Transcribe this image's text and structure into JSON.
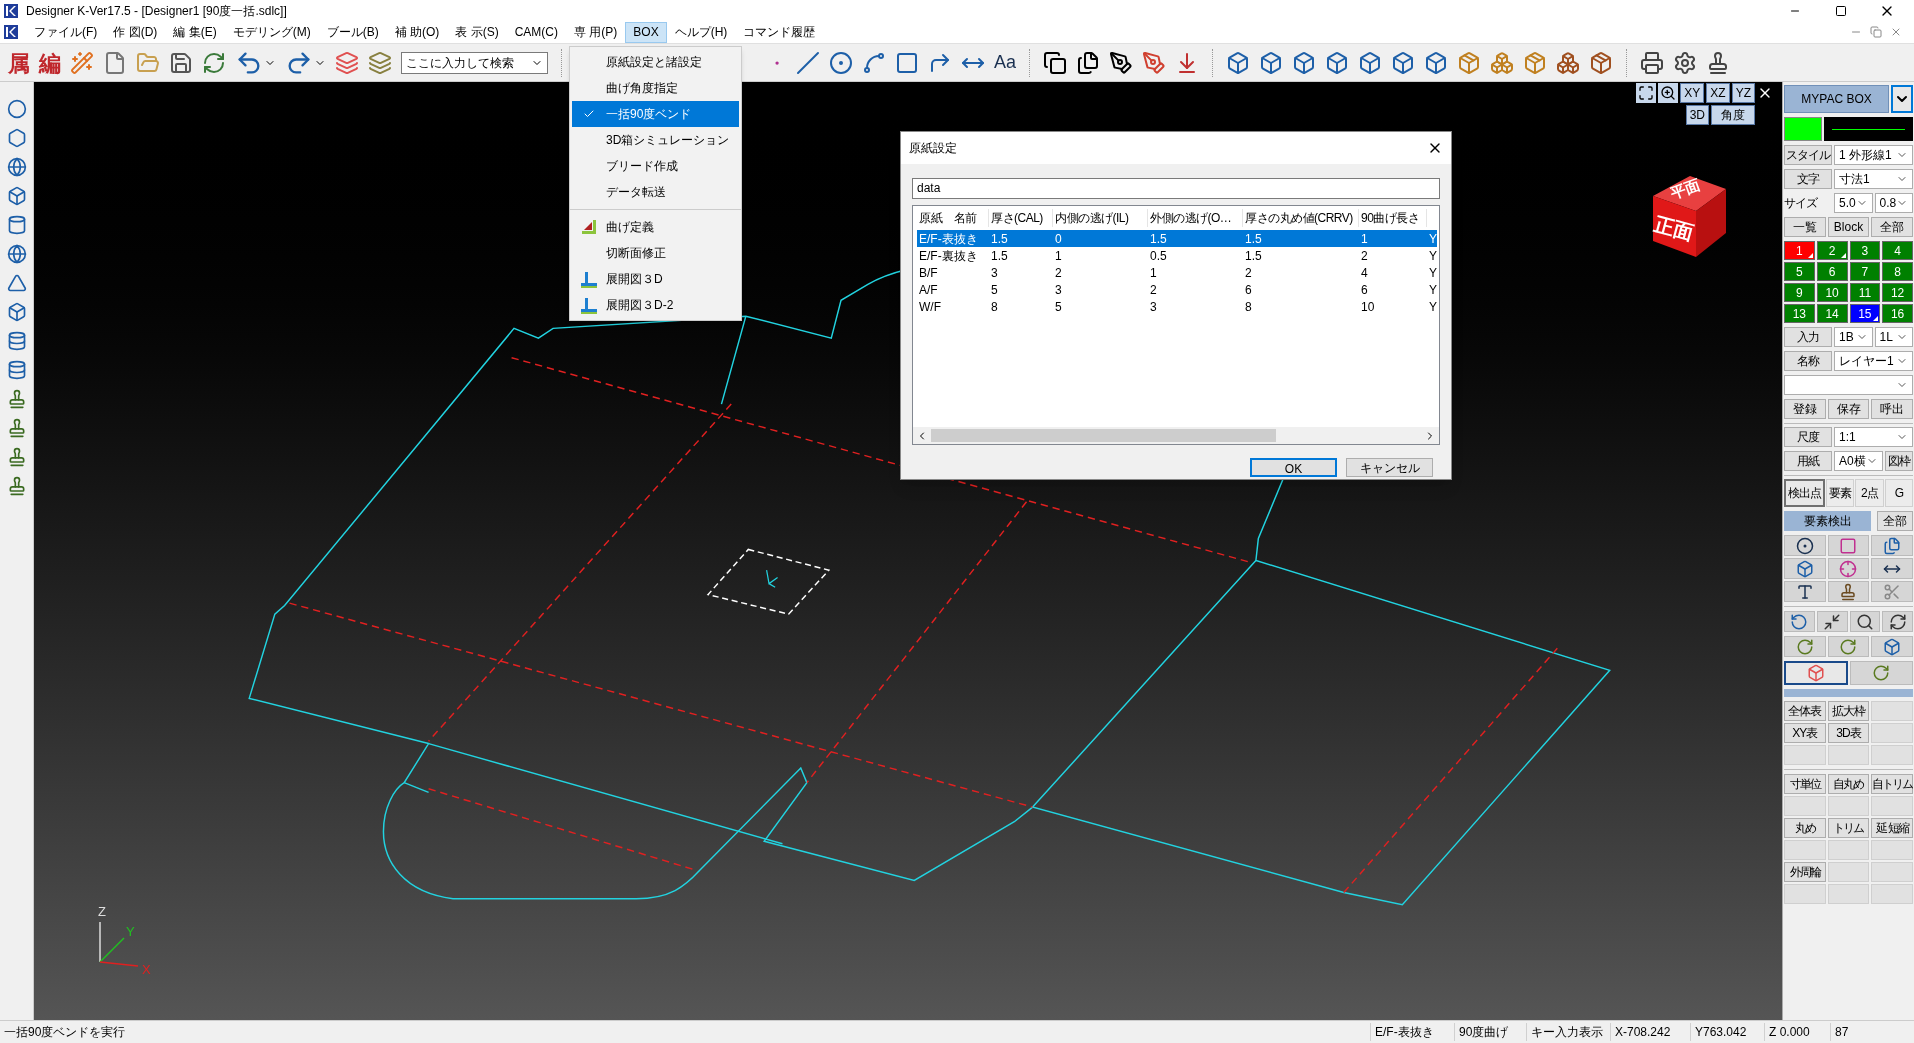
{
  "window": {
    "title": "Designer K-Ver17.5 - [Designer1 [90度一括.sdlc]]"
  },
  "menu_bar": [
    {
      "label": "ファイル(F)",
      "selected": false
    },
    {
      "label": "作 図(D)",
      "selected": false
    },
    {
      "label": "編 集(E)",
      "selected": false
    },
    {
      "label": "モデリング(M)",
      "selected": false
    },
    {
      "label": "ブール(B)",
      "selected": false
    },
    {
      "label": "補 助(O)",
      "selected": false
    },
    {
      "label": "表 示(S)",
      "selected": false
    },
    {
      "label": "CAM(C)",
      "selected": false
    },
    {
      "label": "専 用(P)",
      "selected": false
    },
    {
      "label": "BOX",
      "selected": true
    },
    {
      "label": "ヘルプ(H)",
      "selected": false
    },
    {
      "label": "コマンド履歴",
      "selected": false
    }
  ],
  "toolbar": {
    "glyphs": [
      "属",
      "編"
    ],
    "search": {
      "placeholder": "ここに入力して検索"
    },
    "text_tool": "Aa"
  },
  "box_menu": {
    "groups": [
      [
        {
          "label": "原紙設定と諸設定",
          "kind": "plain",
          "checked": false,
          "selected": false
        },
        {
          "label": "曲げ角度指定",
          "kind": "plain",
          "checked": false,
          "selected": false
        },
        {
          "label": "一括90度ベンド",
          "kind": "plain",
          "checked": true,
          "selected": true
        },
        {
          "label": "3D箱シミュレーション",
          "kind": "plain",
          "checked": false,
          "selected": false
        },
        {
          "label": "ブリード作成",
          "kind": "plain",
          "checked": false,
          "selected": false
        },
        {
          "label": "データ転送",
          "kind": "plain",
          "checked": false,
          "selected": false
        }
      ],
      [
        {
          "label": "曲げ定義",
          "kind": "bend",
          "checked": false,
          "selected": false
        },
        {
          "label": "切断面修正",
          "kind": "plain",
          "checked": false,
          "selected": false
        },
        {
          "label": "展開図３D",
          "kind": "unfold",
          "checked": false,
          "selected": false
        },
        {
          "label": "展開図３D-2",
          "kind": "unfold",
          "checked": false,
          "selected": false
        }
      ]
    ]
  },
  "view_controls": {
    "planes": [
      "XY",
      "XZ",
      "YZ"
    ],
    "mode": "3D",
    "angle": "角度"
  },
  "view_cube": {
    "top": "平面",
    "front": "正面"
  },
  "axes": {
    "z": "Z",
    "y": "Y",
    "x": "X"
  },
  "dialog": {
    "title": "原紙設定",
    "name_field": {
      "value": "data"
    },
    "columns": [
      "原紙　名前",
      "厚さ(CAL)",
      "内側の逃げ(IL)",
      "外側の逃げ(O…",
      "厚さの丸め値(CRRV)",
      "90曲げ長さ"
    ],
    "rows": [
      {
        "cells": [
          "E/F-表抜き",
          "1.5",
          "0",
          "1.5",
          "1.5",
          "1",
          "Y"
        ],
        "selected": true
      },
      {
        "cells": [
          "E/F-裏抜き",
          "1.5",
          "1",
          "0.5",
          "1.5",
          "2",
          "Y"
        ],
        "selected": false
      },
      {
        "cells": [
          "B/F",
          "3",
          "2",
          "1",
          "2",
          "4",
          "Y"
        ],
        "selected": false
      },
      {
        "cells": [
          "A/F",
          "5",
          "3",
          "2",
          "6",
          "6",
          "Y"
        ],
        "selected": false
      },
      {
        "cells": [
          "W/F",
          "8",
          "5",
          "3",
          "8",
          "10",
          "Y"
        ],
        "selected": false
      }
    ],
    "buttons": [
      {
        "label": "OK",
        "default": true
      },
      {
        "label": "キャンセル",
        "default": false
      }
    ]
  },
  "right_panel": {
    "title": "MYPAC BOX",
    "style": {
      "label": "スタイル",
      "value": "1 外形線1"
    },
    "text": {
      "label": "文字",
      "value": "寸法1"
    },
    "size": {
      "label": "サイズ",
      "values": [
        "5.0",
        "0.8"
      ]
    },
    "list_buttons": [
      "一覧",
      "Block",
      "全部"
    ],
    "layers": [
      {
        "label": "1",
        "color": "#ff0000",
        "marked": true
      },
      {
        "label": "2",
        "color": "#008000",
        "marked": true
      },
      {
        "label": "3",
        "color": "#008000",
        "marked": false
      },
      {
        "label": "4",
        "color": "#008000",
        "marked": false
      },
      {
        "label": "5",
        "color": "#008000",
        "marked": false
      },
      {
        "label": "6",
        "color": "#008000",
        "marked": false
      },
      {
        "label": "7",
        "color": "#008000",
        "marked": false
      },
      {
        "label": "8",
        "color": "#008000",
        "marked": false
      },
      {
        "label": "9",
        "color": "#008000",
        "marked": false
      },
      {
        "label": "10",
        "color": "#008000",
        "marked": false
      },
      {
        "label": "11",
        "color": "#008000",
        "marked": false
      },
      {
        "label": "12",
        "color": "#008000",
        "marked": false
      },
      {
        "label": "13",
        "color": "#008000",
        "marked": false
      },
      {
        "label": "14",
        "color": "#008000",
        "marked": false
      },
      {
        "label": "15",
        "color": "#0000ff",
        "marked": true
      },
      {
        "label": "16",
        "color": "#008000",
        "marked": false
      }
    ],
    "input": {
      "label": "入力",
      "values": [
        "1B",
        "1L"
      ]
    },
    "name": {
      "label": "名称",
      "value": "レイヤー1"
    },
    "memory_buttons": [
      "登録",
      "保存",
      "呼出"
    ],
    "scale": {
      "label": "尺度",
      "value": "1:1"
    },
    "paper": {
      "label": "用紙",
      "value": "A0横",
      "frame": "図枠"
    },
    "snap_buttons": [
      {
        "label": "検出点",
        "selected": true
      },
      {
        "label": "要素",
        "selected": false
      },
      {
        "label": "2点",
        "selected": false
      },
      {
        "label": "G",
        "selected": false
      }
    ],
    "detect": {
      "label": "要素検出",
      "all": "全部"
    },
    "view_mode_buttons": [
      {
        "selected": true
      },
      {
        "selected": false
      }
    ],
    "display_buttons": [
      [
        "全体表",
        "拡大枠"
      ],
      [
        "XY表",
        "3D表"
      ]
    ],
    "edit_buttons": [
      [
        "寸単位",
        "自丸め",
        "自トリム"
      ],
      [
        "丸め",
        "トリム",
        "延 短縮"
      ],
      [
        "外周輪"
      ]
    ]
  },
  "status_bar": {
    "message": "一括90度ベンドを実行",
    "fields": [
      "E/F-表抜き",
      "90度曲げ",
      "キー入力表示",
      "X-708.242",
      "Y763.042",
      "Z 0.000",
      "87"
    ]
  }
}
